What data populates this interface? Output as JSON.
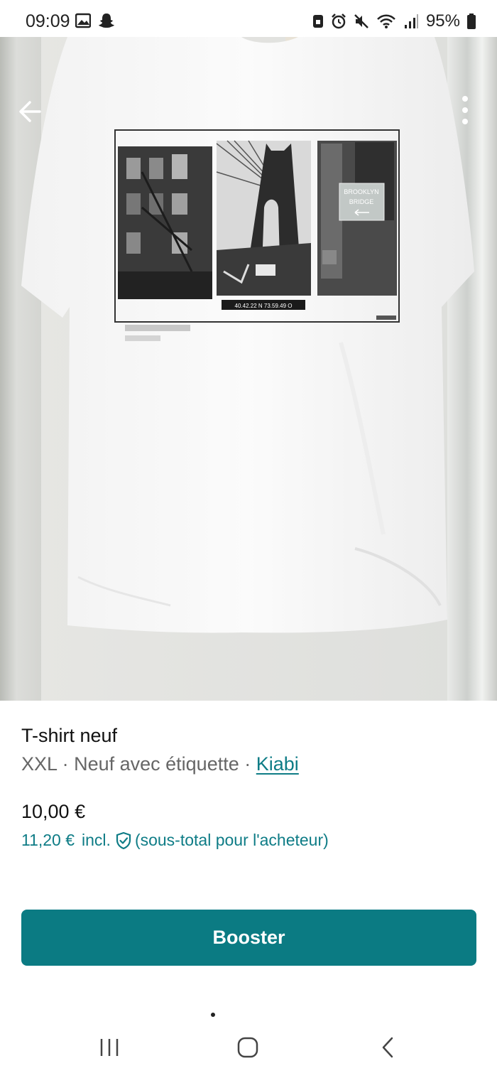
{
  "status_bar": {
    "time": "09:09",
    "battery": "95%",
    "left_icons": [
      "gallery-icon",
      "snapchat-icon"
    ],
    "right_icons": [
      "lock-icon",
      "alarm-icon",
      "mute-icon",
      "wifi-icon",
      "signal-icon",
      "battery-icon"
    ]
  },
  "carousel": {
    "image": "white t-shirt with Brooklyn photo print",
    "print_sign_text": [
      "BROOKLYN",
      "BRIDGE"
    ],
    "print_caption": "40.42.22 N 73.59.49 O",
    "page_index": 1,
    "page_count": 2
  },
  "top_actions": {
    "back_icon": "arrow-left-icon",
    "menu_icon": "kebab-menu-icon"
  },
  "item": {
    "title": "T-shirt neuf",
    "size": "XXL",
    "separator": "·",
    "condition": "Neuf avec étiquette",
    "brand": "Kiabi",
    "price": "10,00 €",
    "price_incl": "11,20 €",
    "incl_label": "incl.",
    "incl_note": "(sous-total pour l'acheteur)"
  },
  "actions": {
    "booster_label": "Booster"
  },
  "colors": {
    "accent": "#0b7b83",
    "link": "#0e7c86"
  }
}
